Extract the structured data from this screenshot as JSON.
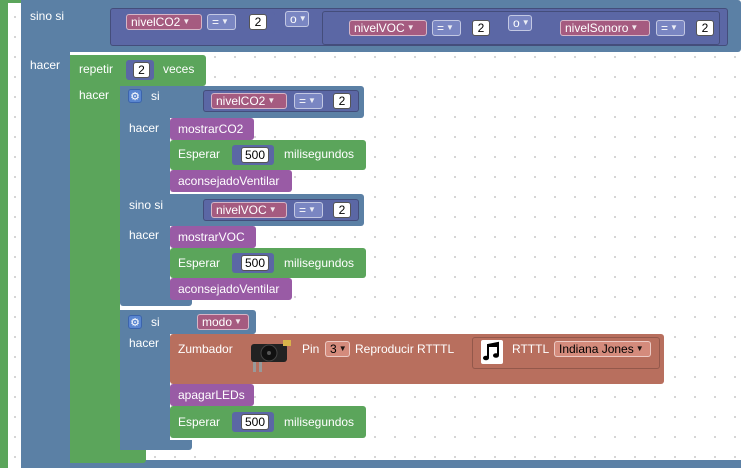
{
  "blocks": {
    "elseif_label": "sino si",
    "do_label": "hacer",
    "repeat_label": "repetir",
    "repeat_count": "2",
    "repeat_suffix": "veces",
    "if_label": "si",
    "or_label": "o",
    "var_co2": "nivelCO2",
    "var_voc": "nivelVOC",
    "var_sound": "nivelSonoro",
    "var_mode": "modo",
    "op_eq": "=",
    "value_2": "2",
    "show_co2": "mostrarCO2",
    "show_voc": "mostrarVOC",
    "wait_label": "Esperar",
    "wait_value": "500",
    "wait_unit": "milisegundos",
    "advise": "aconsejadoVentilar",
    "buzzer_label": "Zumbador",
    "pin_label": "Pin",
    "pin_value": "3",
    "play_label": "Reproducir RTTTL",
    "rtttl_label": "RTTTL",
    "song": "Indiana Jones",
    "leds_off": "apagarLEDs"
  },
  "colors": {
    "control": "#5b80a5",
    "loop": "#5ba55b",
    "logic": "#5b67a5",
    "variable": "#a55b80",
    "procedure": "#995ba5",
    "buzzer": "#b86f5e",
    "rail": "#5ba55b"
  },
  "icons": [
    "gear-icon",
    "music-note-icon",
    "buzzer-module-icon",
    "dropdown-arrow-icon"
  ]
}
